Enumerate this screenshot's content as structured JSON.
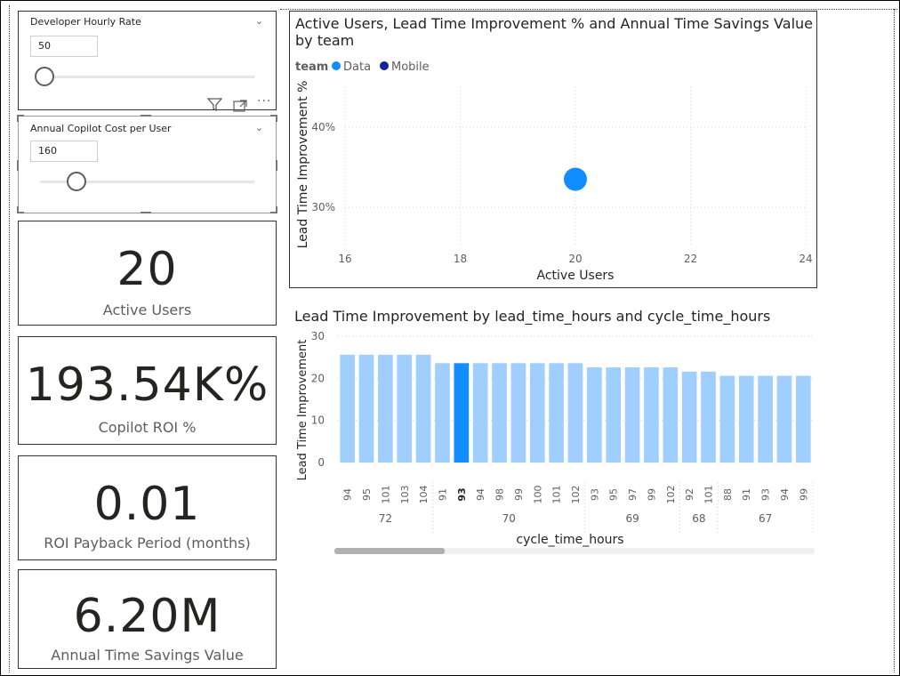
{
  "slicers": {
    "developer_rate": {
      "title": "Developer Hourly Rate",
      "value": "50",
      "level": 0.0
    },
    "copilot_cost": {
      "title": "Annual Copilot Cost per User",
      "value": "160",
      "level": 0.17
    }
  },
  "cards": {
    "active_users": {
      "value": "20",
      "label": "Active Users"
    },
    "roi": {
      "value": "193.54K%",
      "label": "Copilot ROI %"
    },
    "payback": {
      "value": "0.01",
      "label": "ROI Payback Period (months)"
    },
    "savings": {
      "value": "6.20M",
      "label": "Annual Time Savings Value"
    }
  },
  "chart_data": [
    {
      "type": "scatter",
      "title": "Active Users, Lead Time Improvement % and Annual Time Savings Value by team",
      "legend_title": "team",
      "legend": [
        {
          "name": "Data",
          "color": "#118DFF"
        },
        {
          "name": "Mobile",
          "color": "#12239E"
        }
      ],
      "xlabel": "Active Users",
      "ylabel": "Lead Time Improvement %",
      "x_ticks": [
        "16",
        "18",
        "20",
        "22",
        "24"
      ],
      "y_ticks": [
        "30%",
        "40%"
      ],
      "xlim": [
        16,
        24
      ],
      "ylim": [
        25,
        45
      ],
      "points": [
        {
          "series": "Data",
          "x": 20,
          "y": 33.5
        }
      ]
    },
    {
      "type": "bar",
      "title": "Lead Time Improvement by lead_time_hours and cycle_time_hours",
      "xlabel": "cycle_time_hours",
      "ylabel": "Lead Time Improvement",
      "y_ticks": [
        "0",
        "10",
        "20",
        "30"
      ],
      "ylim": [
        0,
        30
      ],
      "categories": [
        "94",
        "95",
        "101",
        "103",
        "104",
        "91",
        "93",
        "94",
        "98",
        "99",
        "100",
        "101",
        "102",
        "93",
        "95",
        "97",
        "99",
        "102",
        "92",
        "101",
        "88",
        "91",
        "93",
        "94",
        "99"
      ],
      "values": [
        25.6,
        25.6,
        25.6,
        25.6,
        25.6,
        23.6,
        23.6,
        23.6,
        23.6,
        23.6,
        23.6,
        23.6,
        23.6,
        22.6,
        22.6,
        22.6,
        22.6,
        22.6,
        21.6,
        21.6,
        20.6,
        20.6,
        20.6,
        20.6,
        20.6
      ],
      "highlight_index": 6,
      "groups": [
        {
          "label": "72",
          "count": 5
        },
        {
          "label": "70",
          "count": 8
        },
        {
          "label": "69",
          "count": 5
        },
        {
          "label": "68",
          "count": 2
        },
        {
          "label": "67",
          "count": 5
        }
      ],
      "bar_color": "#A0CFFF",
      "highlight_color": "#118DFF"
    }
  ]
}
